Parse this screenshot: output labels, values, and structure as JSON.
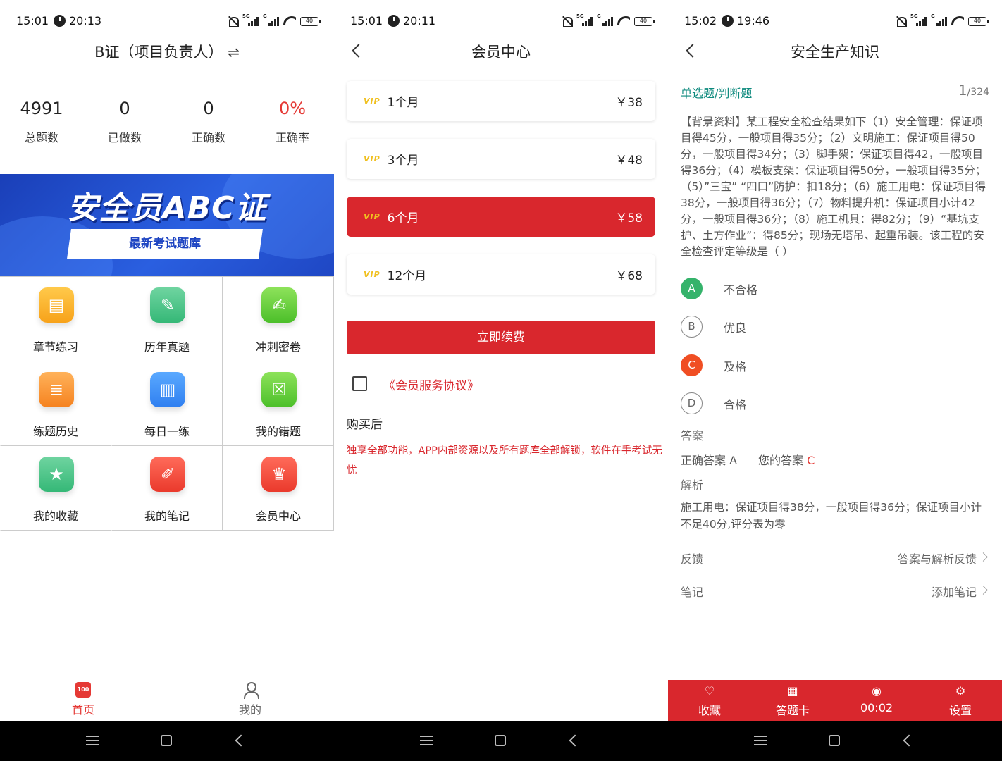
{
  "screens": [
    {
      "status": {
        "time": "15:01",
        "alarm": "20:13",
        "battery": "40"
      },
      "header": {
        "title": "B证（项目负责人）",
        "swap_icon": "⇌"
      },
      "stats": [
        {
          "value": "4991",
          "label": "总题数"
        },
        {
          "value": "0",
          "label": "已做数"
        },
        {
          "value": "0",
          "label": "正确数"
        },
        {
          "value": "0%",
          "label": "正确率"
        }
      ],
      "banner": {
        "title": "安全员ABC证",
        "subtitle": "最新考试题库"
      },
      "grid": [
        {
          "label": "章节练习",
          "icon": "document-icon",
          "color": "#f7a21a"
        },
        {
          "label": "历年真题",
          "icon": "edit-doc-icon",
          "color": "#35b877"
        },
        {
          "label": "冲刺密卷",
          "icon": "pen-paper-icon",
          "color": "#4cbf2a"
        },
        {
          "label": "练题历史",
          "icon": "history-book-icon",
          "color": "#f5821f"
        },
        {
          "label": "每日一练",
          "icon": "file-icon",
          "color": "#2f7ff0"
        },
        {
          "label": "我的错题",
          "icon": "wrong-book-icon",
          "color": "#4cbf2a"
        },
        {
          "label": "我的收藏",
          "icon": "star-folder-icon",
          "color": "#35b877"
        },
        {
          "label": "我的笔记",
          "icon": "note-pen-icon",
          "color": "#ea3a2c"
        },
        {
          "label": "会员中心",
          "icon": "trophy-icon",
          "color": "#ea3a2c"
        }
      ],
      "tabs": [
        {
          "label": "首页",
          "icon_text": "100",
          "active": true
        },
        {
          "label": "我的",
          "active": false
        }
      ]
    },
    {
      "status": {
        "time": "15:01",
        "alarm": "20:11",
        "battery": "40"
      },
      "header": {
        "title": "会员中心"
      },
      "plans": [
        {
          "badge": "VIP",
          "name": "1个月",
          "price": "￥38",
          "selected": false
        },
        {
          "badge": "VIP",
          "name": "3个月",
          "price": "￥48",
          "selected": false
        },
        {
          "badge": "VIP",
          "name": "6个月",
          "price": "￥58",
          "selected": true
        },
        {
          "badge": "VIP",
          "name": "12个月",
          "price": "￥68",
          "selected": false
        }
      ],
      "renew_button": "立即续费",
      "agreement": "《会员服务协议》",
      "after_purchase_title": "购买后",
      "after_purchase_desc": "独享全部功能，APP内部资源以及所有题库全部解锁，软件在手考试无忧"
    },
    {
      "status": {
        "time": "15:02",
        "alarm": "19:46",
        "battery": "40"
      },
      "header": {
        "title": "安全生产知识"
      },
      "question_type": "单选题/判断题",
      "question_index": "1",
      "question_total": "/324",
      "question_text": "【背景资料】某工程安全检查结果如下（1）安全管理：保证项目得45分，一般项目得35分；（2）文明施工：保证项目得50分，一般项目得34分；（3）脚手架：保证项目得42，一般项目得36分；（4）模板支架：保证项目得50分，一般项目得35分；（5）”三宝” “四口”防护：扣18分；（6）施工用电：保证项目得38分，一般项目得36分；（7）物料提升机：保证项目小计42分，一般项目得36分；（8）施工机具：得82分；（9）“基坑支护、土方作业”：得85分；现场无塔吊、起重吊装。该工程的安全检查评定等级是（ ）",
      "options": [
        {
          "letter": "A",
          "text": "不合格",
          "state": "correct"
        },
        {
          "letter": "B",
          "text": "优良",
          "state": "none"
        },
        {
          "letter": "C",
          "text": "及格",
          "state": "wrong"
        },
        {
          "letter": "D",
          "text": "合格",
          "state": "none"
        }
      ],
      "answer_label": "答案",
      "correct_answer_label": "正确答案",
      "correct_answer": "A",
      "your_answer_label": "您的答案",
      "your_answer": "C",
      "analysis_label": "解析",
      "analysis_text": "施工用电：保证项目得38分，一般项目得36分；保证项目小计不足40分,评分表为零",
      "feedback_label": "反馈",
      "feedback_action": "答案与解析反馈",
      "note_label": "笔记",
      "note_action": "添加笔记",
      "bottom_bar": [
        {
          "label": "收藏",
          "icon": "heart-icon"
        },
        {
          "label": "答题卡",
          "icon": "grid-card-icon"
        },
        {
          "label": "00:02",
          "icon": "clock-check-icon"
        },
        {
          "label": "设置",
          "icon": "gear-icon"
        }
      ],
      "accent_color": "#d9272d"
    }
  ]
}
